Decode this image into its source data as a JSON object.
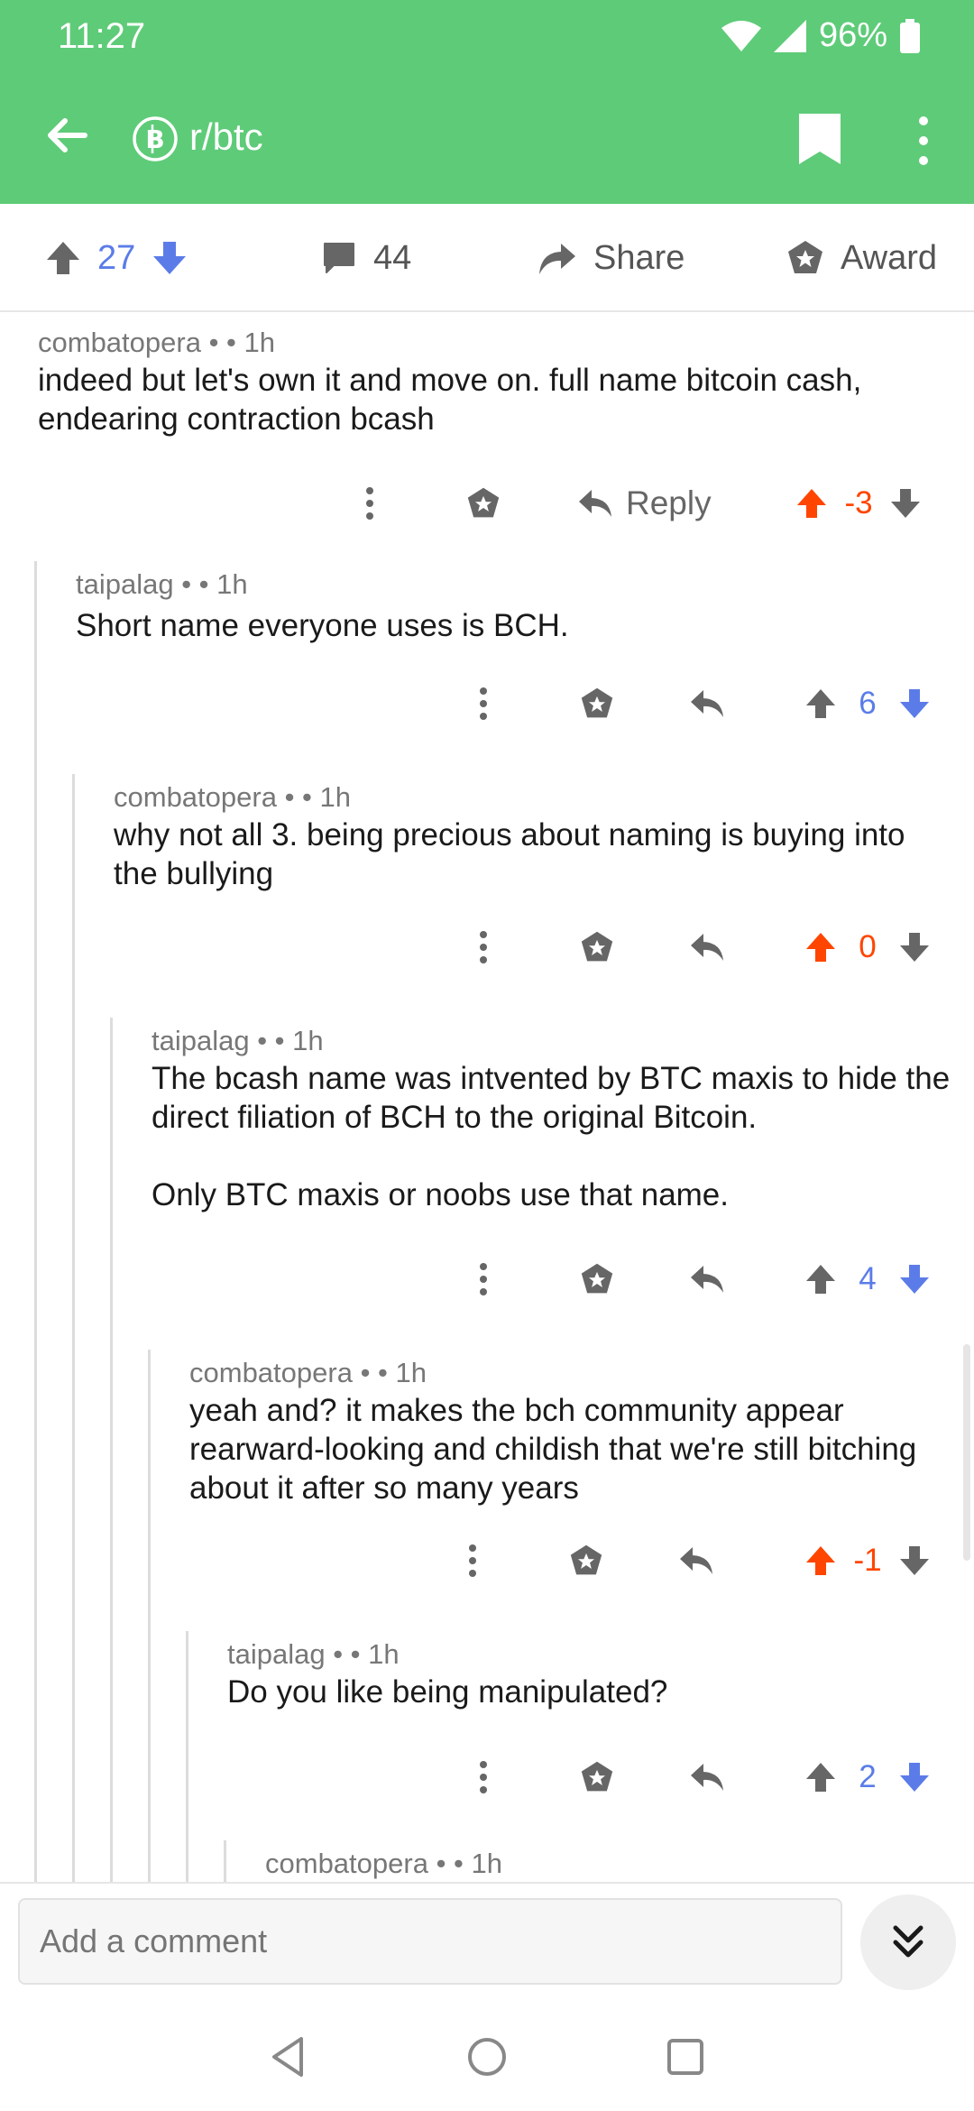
{
  "status_bar": {
    "time": "11:27",
    "battery": "96%"
  },
  "app_bar": {
    "subreddit": "r/btc"
  },
  "post_bar": {
    "score": "27",
    "comments": "44",
    "share_label": "Share",
    "award_label": "Award"
  },
  "colors": {
    "brand_green": "#5ecb78",
    "upvote_orange": "#ff4500",
    "vote_blue": "#5b7ce8",
    "icon_gray": "#666666"
  },
  "comments": [
    {
      "author": "combatopera",
      "age": "1h",
      "text": "indeed but let's own it and move on. full name bitcoin cash, endearing contraction bcash",
      "score": "-3",
      "vote": "up",
      "reply_label": "Reply"
    },
    {
      "author": "taipalag",
      "age": "1h",
      "text": "Short name everyone uses is BCH.",
      "score": "6",
      "vote": "none"
    },
    {
      "author": "combatopera",
      "age": "1h",
      "text": "why not all 3. being precious about naming is buying into the bullying",
      "score": "0",
      "vote": "up"
    },
    {
      "author": "taipalag",
      "age": "1h",
      "text": "The bcash name was intvented by BTC maxis to hide the direct filiation of BCH to the original Bitcoin.\n\nOnly BTC maxis or noobs use that name.",
      "score": "4",
      "vote": "none"
    },
    {
      "author": "combatopera",
      "age": "1h",
      "text": "yeah and? it makes the bch community appear rearward-looking and childish that we're still bitching about it after so many years",
      "score": "-1",
      "vote": "up"
    },
    {
      "author": "taipalag",
      "age": "1h",
      "text": "Do you like being manipulated?",
      "score": "2",
      "vote": "none"
    },
    {
      "author": "combatopera",
      "age": "1h",
      "text": "",
      "score": "",
      "vote": "none"
    }
  ],
  "composer": {
    "placeholder": "Add a comment"
  },
  "icons": [
    "back-arrow-icon",
    "bitcoin-logo-icon",
    "bookmark-icon",
    "overflow-menu-icon",
    "upvote-icon",
    "downvote-icon",
    "comment-bubble-icon",
    "share-icon",
    "award-icon",
    "reply-icon",
    "more-dots-icon",
    "double-chevron-down-icon",
    "nav-back-icon",
    "nav-home-icon",
    "nav-recents-icon"
  ]
}
